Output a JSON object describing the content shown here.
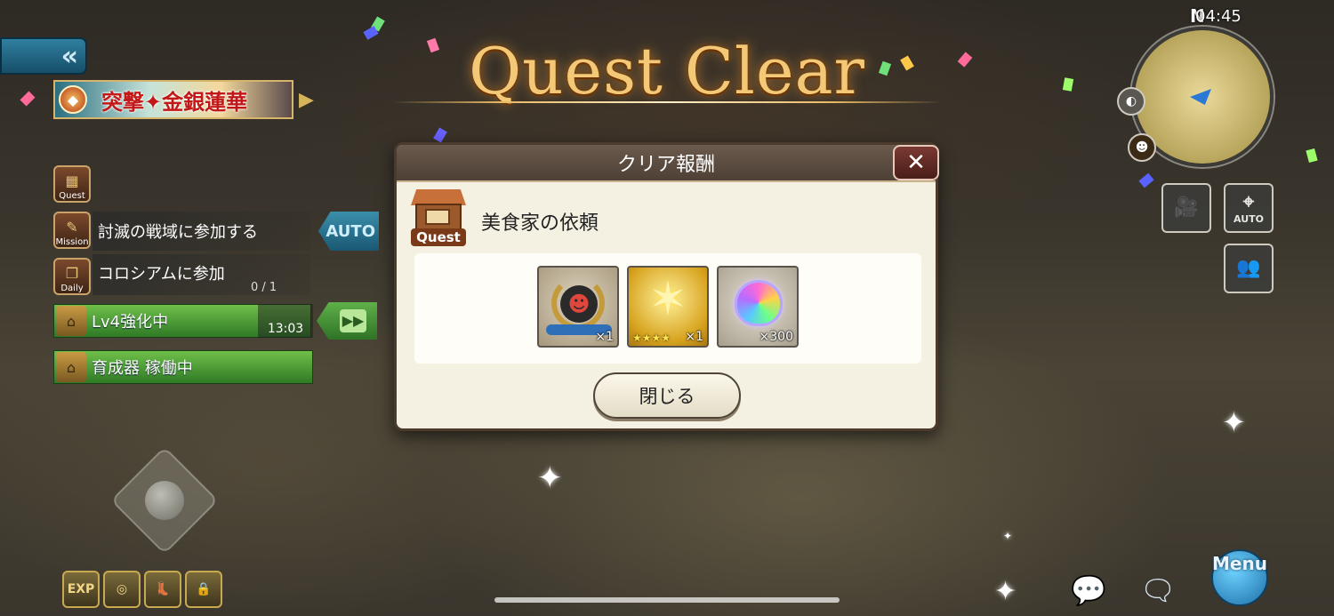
{
  "status_bar": {
    "time": "04:45"
  },
  "title": "Quest Clear",
  "left_panel": {
    "back_glyph": "«",
    "event_banner": {
      "emblem": "◆",
      "label": "突撃✦金銀蓮華"
    },
    "quest_icon_label": "Quest",
    "mission": {
      "icon_label": "Mission",
      "text": "討滅の戦域に参加する",
      "auto_label": "AUTO"
    },
    "daily": {
      "icon_label": "Daily",
      "text": "コロシアムに参加",
      "progress": "0 / 1"
    },
    "enhance": {
      "text": "Lv4強化中",
      "timer": "13:03"
    },
    "incubator": {
      "text": "育成器 稼働中"
    },
    "bottom_bar": [
      "EXP",
      "◎",
      "👢",
      "🔒"
    ]
  },
  "dialog": {
    "header": "クリア報酬",
    "close_glyph": "✕",
    "quest_icon_label": "Quest",
    "quest_name": "美食家の依頼",
    "rewards": [
      {
        "icon": "demon-emblem",
        "qty": "×1"
      },
      {
        "icon": "star-crystal",
        "stars": "★★★★",
        "qty": "×1"
      },
      {
        "icon": "rainbow-gem",
        "qty": "×300"
      }
    ],
    "close_button_label": "閉じる"
  },
  "right_panel": {
    "minimap_north": "N",
    "camera_glyph": "🎥",
    "auto_label": "AUTO",
    "party_glyph": "👥",
    "menu_label": "Menu"
  },
  "colors": {
    "title_gold": "#f3c877",
    "dialog_bg": "#f5f1e2",
    "green_bar": "#4f9e38",
    "blue_accent": "#2f7fa0"
  }
}
